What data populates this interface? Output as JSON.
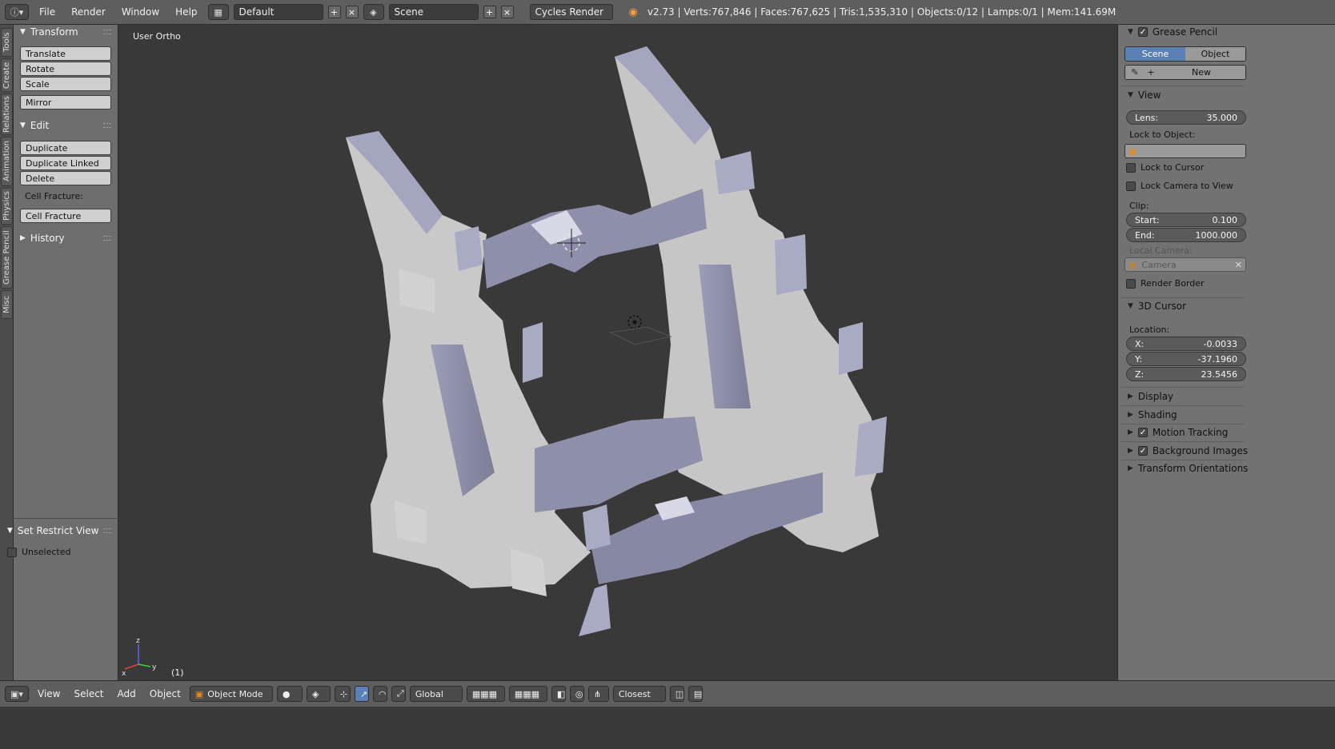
{
  "topbar": {
    "menus": [
      "File",
      "Render",
      "Window",
      "Help"
    ],
    "layout": "Default",
    "scene": "Scene",
    "engine": "Cycles Render",
    "stats": "v2.73 | Verts:767,846 | Faces:767,625 | Tris:1,535,310 | Objects:0/12 | Lamps:0/1 | Mem:141.69M"
  },
  "left_tabs": [
    "Tools",
    "Create",
    "Relations",
    "Animation",
    "Physics",
    "Grease Pencil",
    "Misc"
  ],
  "toolshelf": {
    "transform_title": "Transform",
    "translate": "Translate",
    "rotate": "Rotate",
    "scale": "Scale",
    "mirror": "Mirror",
    "edit_title": "Edit",
    "duplicate": "Duplicate",
    "duplicate_linked": "Duplicate Linked",
    "delete": "Delete",
    "cell_fracture_label": "Cell Fracture:",
    "cell_fracture": "Cell Fracture",
    "history_title": "History",
    "restrict_title": "Set Restrict View",
    "unselected": "Unselected"
  },
  "viewport": {
    "label": "User Ortho",
    "frame": "(1)",
    "axis_x": "x",
    "axis_y": "y",
    "axis_z": "z"
  },
  "properties": {
    "grease_pencil": "Grease Pencil",
    "scene_tab": "Scene",
    "object_tab": "Object",
    "new_button": "New",
    "view_title": "View",
    "lens_label": "Lens:",
    "lens_value": "35.000",
    "lock_to_object": "Lock to Object:",
    "lock_to_cursor": "Lock to Cursor",
    "lock_camera_to_view": "Lock Camera to View",
    "clip_label": "Clip:",
    "start_label": "Start:",
    "start_value": "0.100",
    "end_label": "End:",
    "end_value": "1000.000",
    "local_camera": "Local Camera:",
    "camera_value": "Camera",
    "render_border": "Render Border",
    "cursor_title": "3D Cursor",
    "location_label": "Location:",
    "x_label": "X:",
    "x_value": "-0.0033",
    "y_label": "Y:",
    "y_value": "-37.1960",
    "z_label": "Z:",
    "z_value": "23.5456",
    "display": "Display",
    "shading": "Shading",
    "motion_tracking": "Motion Tracking",
    "background_images": "Background Images",
    "transform_orientations": "Transform Orientations"
  },
  "bottombar": {
    "menus": [
      "View",
      "Select",
      "Add",
      "Object"
    ],
    "mode": "Object Mode",
    "orientation": "Global",
    "snap": "Closest"
  },
  "colors": {
    "accent": "#5a80b6",
    "mesh_light": "#c8c8c8",
    "mesh_shadow": "#8e90ab"
  }
}
